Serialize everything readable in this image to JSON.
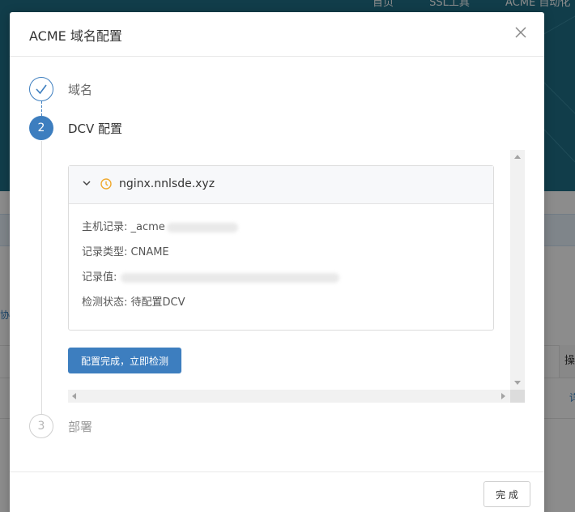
{
  "background": {
    "nav": [
      "首页",
      "SSL工具",
      "ACME 自动化"
    ],
    "left_text": "协",
    "table_op_header": "操",
    "table_op_link": "详"
  },
  "modal": {
    "title": "ACME 域名配置",
    "steps": [
      {
        "label": "域名",
        "status": "done",
        "icon": "check-icon"
      },
      {
        "label": "DCV 配置",
        "status": "active",
        "number": "2"
      },
      {
        "label": "部署",
        "status": "wait",
        "number": "3"
      }
    ],
    "dcv": {
      "domain": "nginx.nnlsde.xyz",
      "status_icon": "warning-icon",
      "host_record_label": "主机记录: _acme",
      "record_type_label": "记录类型: CNAME",
      "record_value_label": "记录值: ",
      "check_status_label": "检测状态: 待配置DCV",
      "check_button": "配置完成，立即检测"
    },
    "footer": {
      "finish_button": "完 成"
    }
  },
  "colors": {
    "primary": "#3d7ebf",
    "warning": "#f0a92e",
    "header_bg": "#1f6f87"
  }
}
